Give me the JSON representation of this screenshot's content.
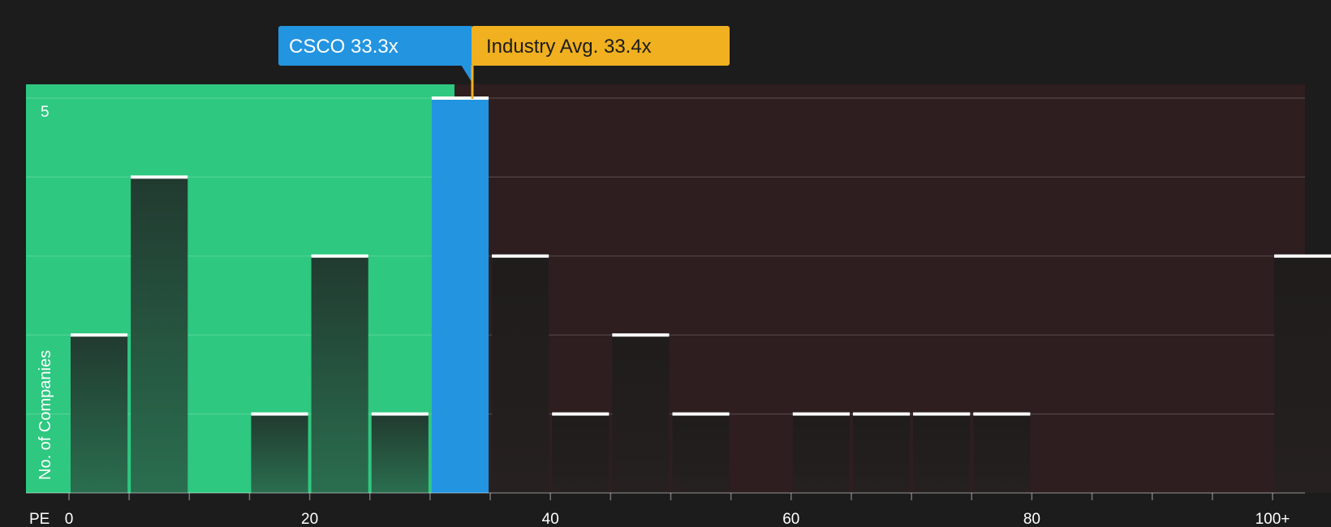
{
  "chart_data": {
    "type": "bar",
    "x_axis_label": "PE",
    "y_axis_label": "No. of Companies",
    "x_tick_labels": [
      "0",
      "20",
      "40",
      "60",
      "80",
      "100+"
    ],
    "y_tick_label": "5",
    "ylim": [
      0,
      5
    ],
    "bin_width": 5,
    "bins": [
      {
        "start": 0,
        "count": 2
      },
      {
        "start": 5,
        "count": 4
      },
      {
        "start": 10,
        "count": 0
      },
      {
        "start": 15,
        "count": 1
      },
      {
        "start": 20,
        "count": 3
      },
      {
        "start": 25,
        "count": 1
      },
      {
        "start": 30,
        "count": 5,
        "highlight": true
      },
      {
        "start": 35,
        "count": 3
      },
      {
        "start": 40,
        "count": 1
      },
      {
        "start": 45,
        "count": 2
      },
      {
        "start": 50,
        "count": 1
      },
      {
        "start": 55,
        "count": 0
      },
      {
        "start": 60,
        "count": 1
      },
      {
        "start": 65,
        "count": 1
      },
      {
        "start": 70,
        "count": 1
      },
      {
        "start": 75,
        "count": 1
      },
      {
        "start": 80,
        "count": 0
      },
      {
        "start": 85,
        "count": 0
      },
      {
        "start": 90,
        "count": 0
      },
      {
        "start": 95,
        "count": 0
      },
      {
        "start": 100,
        "count": 3
      }
    ],
    "company": {
      "label": "CSCO 33.3x",
      "value": 33.3
    },
    "industry_avg": {
      "label": "Industry Avg. 33.4x",
      "value": 33.4
    },
    "colors": {
      "background": "#1c1c1c",
      "undervalued_zone": "#2ec880",
      "overvalued_zone": "#2e1e1f",
      "bar_highlight": "#2394e0",
      "company_label_bg": "#2394e0",
      "industry_label_bg": "#f0b01f",
      "bar_cap": "#ffffff"
    }
  }
}
